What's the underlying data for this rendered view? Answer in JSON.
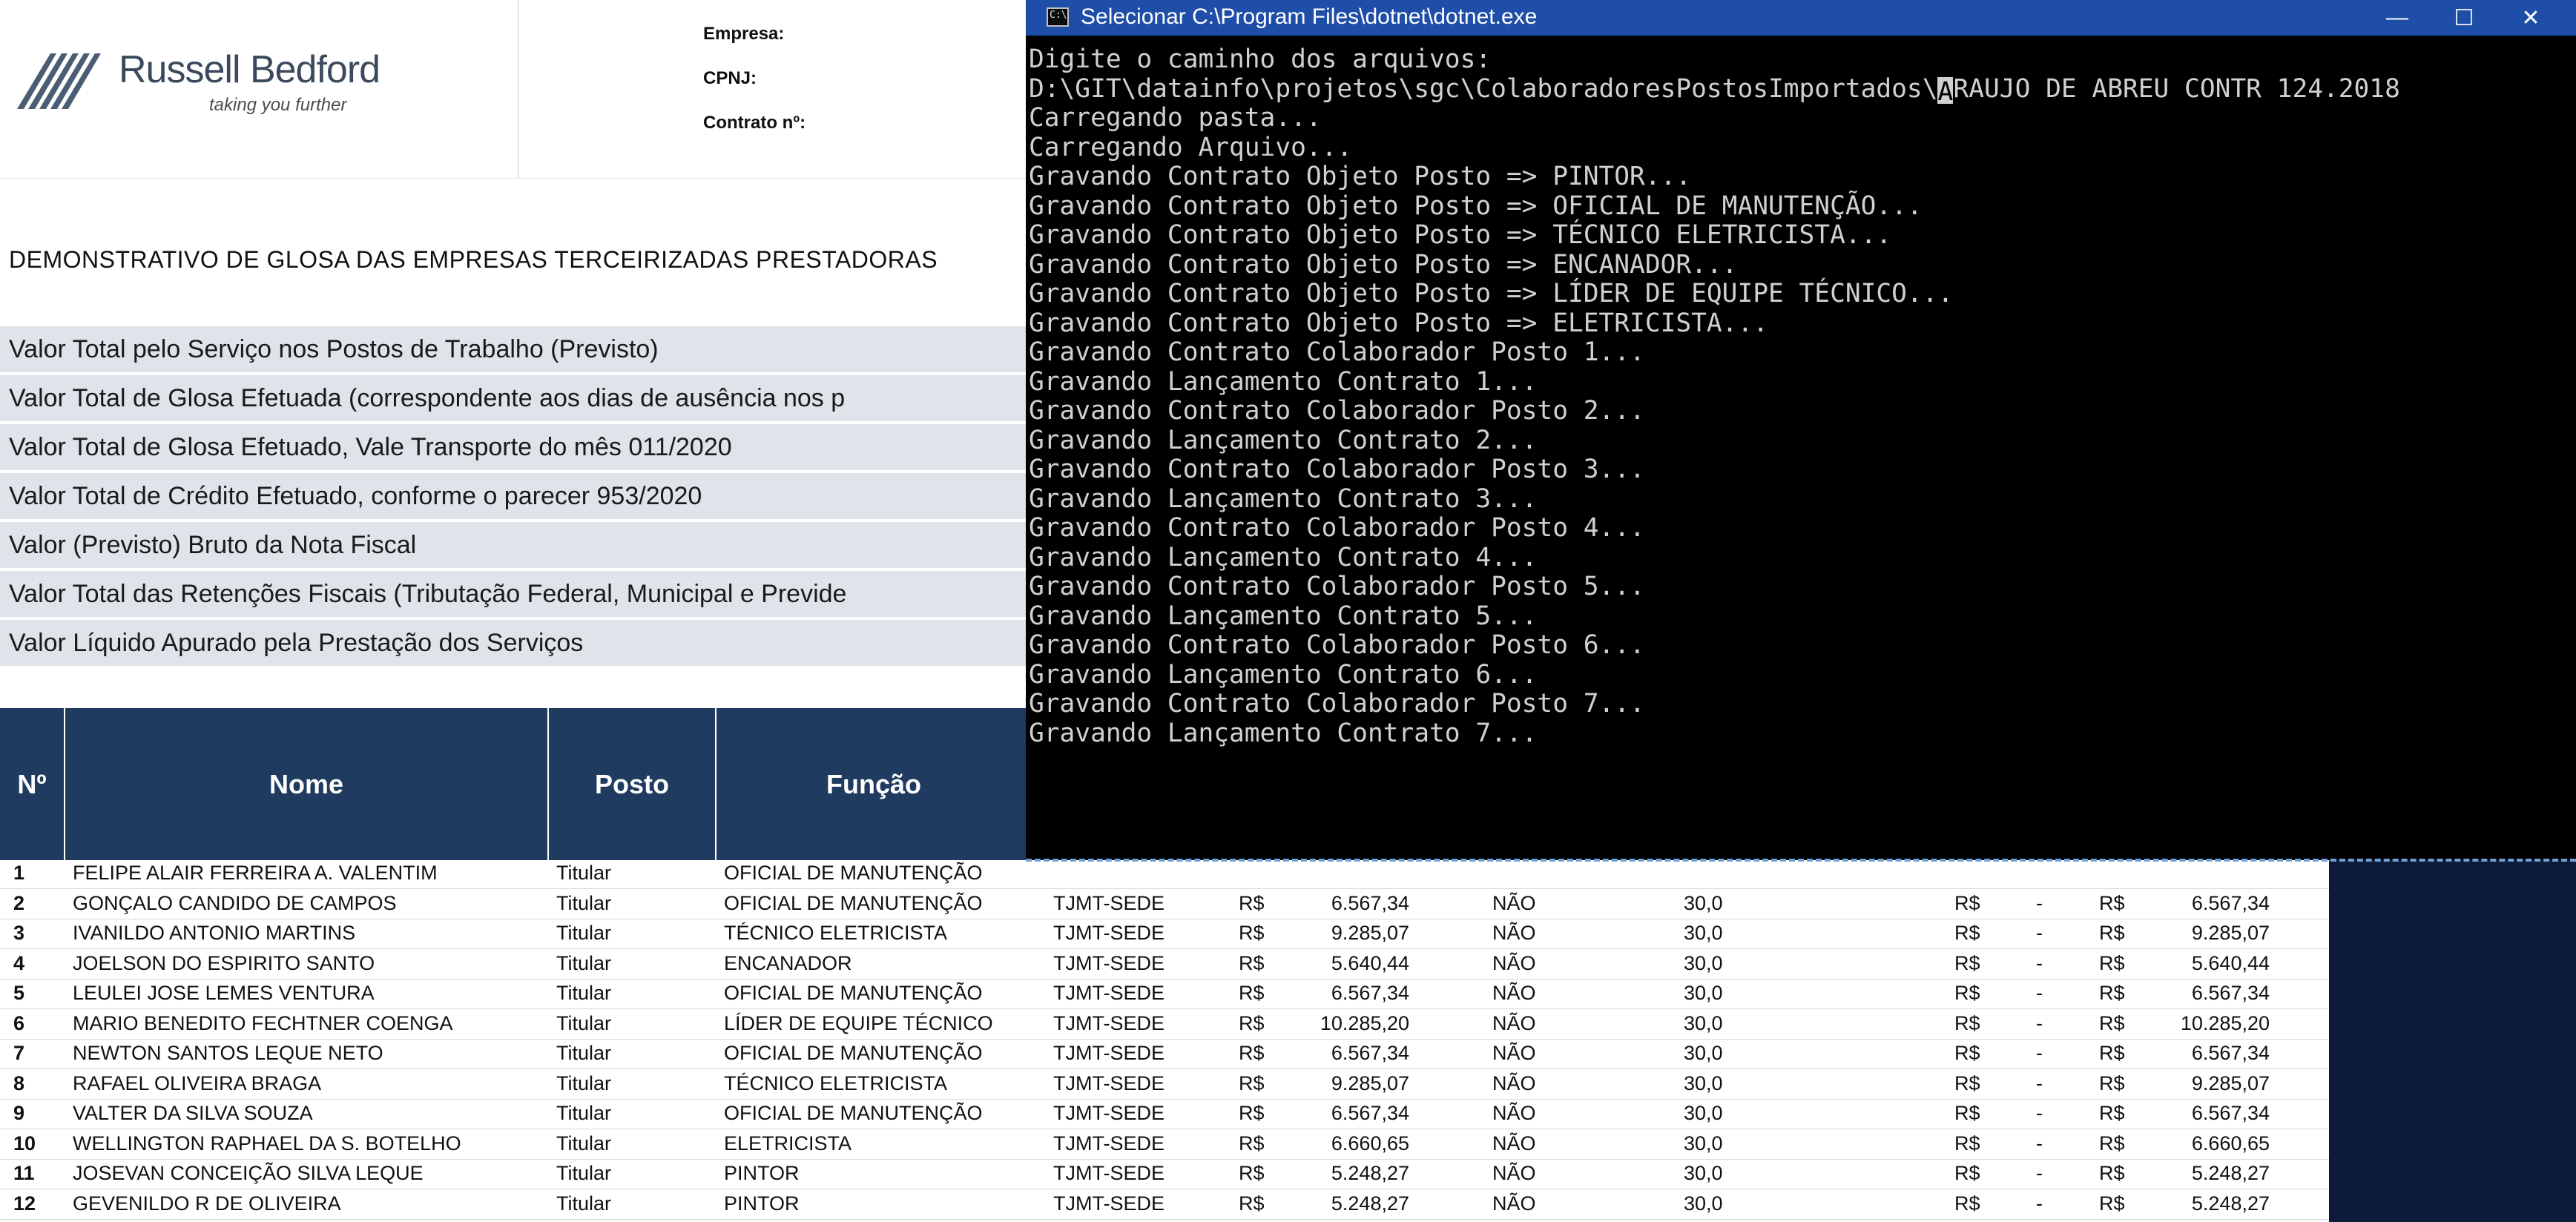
{
  "sheet": {
    "brand": "Russell Bedford",
    "tagline": "taking you further",
    "meta": [
      "Empresa:",
      "CPNJ:",
      "Contrato nº:"
    ],
    "doc_title": "DEMONSTRATIVO DE GLOSA DAS EMPRESAS TERCEIRIZADAS PRESTADORAS",
    "summary_rows": [
      "Valor Total pelo Serviço nos Postos de Trabalho (Previsto)",
      "Valor Total de Glosa Efetuada (correspondente aos dias de ausência nos p",
      "Valor Total de Glosa Efetuado, Vale Transporte do mês 011/2020",
      "Valor Total de Crédito Efetuado, conforme o parecer 953/2020",
      "Valor (Previsto) Bruto da Nota Fiscal",
      "Valor Total das Retenções Fiscais (Tributação Federal, Municipal e Previde",
      "Valor Líquido Apurado pela Prestação dos Serviços"
    ],
    "headers": [
      "Nº",
      "Nome",
      "Posto",
      "Função"
    ],
    "rows": [
      {
        "n": "1",
        "nome": "FELIPE ALAIR FERREIRA A. VALENTIM",
        "posto": "Titular",
        "funcao": "OFICIAL DE MANUTENÇÃO",
        "local": "",
        "rs1": "",
        "valor": "",
        "nao": "",
        "dias": "",
        "rs2": "",
        "dash": "",
        "rs3": "",
        "total": ""
      },
      {
        "n": "2",
        "nome": "GONÇALO CANDIDO DE CAMPOS",
        "posto": "Titular",
        "funcao": "OFICIAL DE MANUTENÇÃO",
        "local": "TJMT-SEDE",
        "rs1": "R$",
        "valor": "6.567,34",
        "nao": "NÃO",
        "dias": "30,0",
        "rs2": "R$",
        "dash": "-",
        "rs3": "R$",
        "total": "6.567,34"
      },
      {
        "n": "3",
        "nome": "IVANILDO ANTONIO MARTINS",
        "posto": "Titular",
        "funcao": "TÉCNICO ELETRICISTA",
        "local": "TJMT-SEDE",
        "rs1": "R$",
        "valor": "9.285,07",
        "nao": "NÃO",
        "dias": "30,0",
        "rs2": "R$",
        "dash": "-",
        "rs3": "R$",
        "total": "9.285,07"
      },
      {
        "n": "4",
        "nome": "JOELSON DO ESPIRITO SANTO",
        "posto": "Titular",
        "funcao": "ENCANADOR",
        "local": "TJMT-SEDE",
        "rs1": "R$",
        "valor": "5.640,44",
        "nao": "NÃO",
        "dias": "30,0",
        "rs2": "R$",
        "dash": "-",
        "rs3": "R$",
        "total": "5.640,44"
      },
      {
        "n": "5",
        "nome": "LEULEI JOSE LEMES VENTURA",
        "posto": "Titular",
        "funcao": "OFICIAL DE MANUTENÇÃO",
        "local": "TJMT-SEDE",
        "rs1": "R$",
        "valor": "6.567,34",
        "nao": "NÃO",
        "dias": "30,0",
        "rs2": "R$",
        "dash": "-",
        "rs3": "R$",
        "total": "6.567,34"
      },
      {
        "n": "6",
        "nome": "MARIO BENEDITO FECHTNER COENGA",
        "posto": "Titular",
        "funcao": "LÍDER DE EQUIPE TÉCNICO",
        "local": "TJMT-SEDE",
        "rs1": "R$",
        "valor": "10.285,20",
        "nao": "NÃO",
        "dias": "30,0",
        "rs2": "R$",
        "dash": "-",
        "rs3": "R$",
        "total": "10.285,20"
      },
      {
        "n": "7",
        "nome": "NEWTON SANTOS LEQUE NETO",
        "posto": "Titular",
        "funcao": "OFICIAL DE MANUTENÇÃO",
        "local": "TJMT-SEDE",
        "rs1": "R$",
        "valor": "6.567,34",
        "nao": "NÃO",
        "dias": "30,0",
        "rs2": "R$",
        "dash": "-",
        "rs3": "R$",
        "total": "6.567,34"
      },
      {
        "n": "8",
        "nome": "RAFAEL OLIVEIRA BRAGA",
        "posto": "Titular",
        "funcao": "TÉCNICO ELETRICISTA",
        "local": "TJMT-SEDE",
        "rs1": "R$",
        "valor": "9.285,07",
        "nao": "NÃO",
        "dias": "30,0",
        "rs2": "R$",
        "dash": "-",
        "rs3": "R$",
        "total": "9.285,07"
      },
      {
        "n": "9",
        "nome": "VALTER DA SILVA SOUZA",
        "posto": "Titular",
        "funcao": "OFICIAL DE MANUTENÇÃO",
        "local": "TJMT-SEDE",
        "rs1": "R$",
        "valor": "6.567,34",
        "nao": "NÃO",
        "dias": "30,0",
        "rs2": "R$",
        "dash": "-",
        "rs3": "R$",
        "total": "6.567,34"
      },
      {
        "n": "10",
        "nome": "WELLINGTON RAPHAEL DA S. BOTELHO",
        "posto": "Titular",
        "funcao": "ELETRICISTA",
        "local": "TJMT-SEDE",
        "rs1": "R$",
        "valor": "6.660,65",
        "nao": "NÃO",
        "dias": "30,0",
        "rs2": "R$",
        "dash": "-",
        "rs3": "R$",
        "total": "6.660,65"
      },
      {
        "n": "11",
        "nome": "JOSEVAN CONCEIÇÃO SILVA LEQUE",
        "posto": "Titular",
        "funcao": "PINTOR",
        "local": "TJMT-SEDE",
        "rs1": "R$",
        "valor": "5.248,27",
        "nao": "NÃO",
        "dias": "30,0",
        "rs2": "R$",
        "dash": "-",
        "rs3": "R$",
        "total": "5.248,27"
      },
      {
        "n": "12",
        "nome": "GEVENILDO R DE OLIVEIRA",
        "posto": "Titular",
        "funcao": "PINTOR",
        "local": "TJMT-SEDE",
        "rs1": "R$",
        "valor": "5.248,27",
        "nao": "NÃO",
        "dias": "30,0",
        "rs2": "R$",
        "dash": "-",
        "rs3": "R$",
        "total": "5.248,27"
      }
    ]
  },
  "console": {
    "title": "Selecionar C:\\Program Files\\dotnet\\dotnet.exe",
    "minimize": "—",
    "maximize": "☐",
    "close": "✕",
    "path_prefix": "D:\\GIT\\datainfo\\projetos\\sgc\\ColaboradoresPostosImportados\\",
    "path_cursor": "A",
    "path_suffix": "RAUJO DE ABREU CONTR 124.2018",
    "lines_before": [
      "Digite o caminho dos arquivos:"
    ],
    "lines_after": [
      "Carregando pasta...",
      "Carregando Arquivo...",
      "Gravando Contrato Objeto Posto => PINTOR...",
      "Gravando Contrato Objeto Posto => OFICIAL DE MANUTENÇÃO...",
      "Gravando Contrato Objeto Posto => TÉCNICO ELETRICISTA...",
      "Gravando Contrato Objeto Posto => ENCANADOR...",
      "Gravando Contrato Objeto Posto => LÍDER DE EQUIPE TÉCNICO...",
      "Gravando Contrato Objeto Posto => ELETRICISTA...",
      "Gravando Contrato Colaborador Posto 1...",
      "Gravando Lançamento Contrato 1...",
      "Gravando Contrato Colaborador Posto 2...",
      "Gravando Lançamento Contrato 2...",
      "Gravando Contrato Colaborador Posto 3...",
      "Gravando Lançamento Contrato 3...",
      "Gravando Contrato Colaborador Posto 4...",
      "Gravando Lançamento Contrato 4...",
      "Gravando Contrato Colaborador Posto 5...",
      "Gravando Lançamento Contrato 5...",
      "Gravando Contrato Colaborador Posto 6...",
      "Gravando Lançamento Contrato 6...",
      "Gravando Contrato Colaborador Posto 7...",
      "Gravando Lançamento Contrato 7..."
    ]
  }
}
